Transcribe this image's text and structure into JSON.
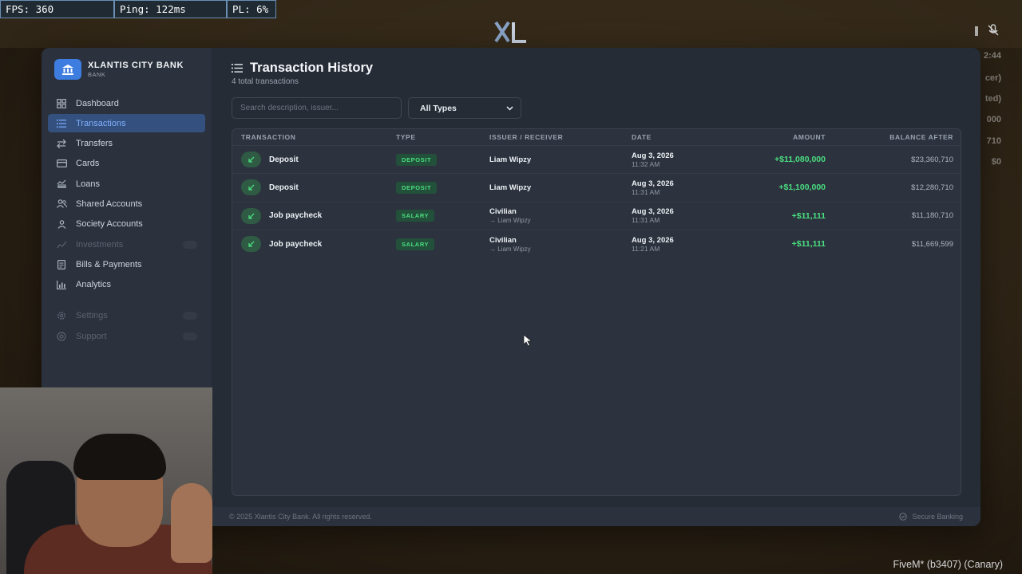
{
  "debug": {
    "fps": "FPS: 360",
    "ping": "Ping: 122ms",
    "pl": "PL: 6%"
  },
  "background_hud": [
    "2:44",
    "cer)",
    "ted)",
    "000",
    "710",
    "$0"
  ],
  "brand": {
    "title": "XLANTIS CITY BANK",
    "subtitle": "BANK",
    "icon": "bank-icon",
    "accent": "#3e7de0"
  },
  "nav": {
    "items": [
      {
        "label": "Dashboard",
        "icon": "dashboard-icon",
        "state": "normal"
      },
      {
        "label": "Transactions",
        "icon": "list-icon",
        "state": "active"
      },
      {
        "label": "Transfers",
        "icon": "transfer-icon",
        "state": "normal"
      },
      {
        "label": "Cards",
        "icon": "card-icon",
        "state": "normal"
      },
      {
        "label": "Loans",
        "icon": "loan-icon",
        "state": "normal"
      },
      {
        "label": "Shared Accounts",
        "icon": "users-icon",
        "state": "normal"
      },
      {
        "label": "Society Accounts",
        "icon": "society-icon",
        "state": "normal"
      },
      {
        "label": "Investments",
        "icon": "chart-icon",
        "state": "disabled"
      },
      {
        "label": "Bills & Payments",
        "icon": "bill-icon",
        "state": "normal"
      },
      {
        "label": "Analytics",
        "icon": "analytics-icon",
        "state": "normal"
      }
    ],
    "bottom_items": [
      {
        "label": "Settings",
        "icon": "gear-icon",
        "state": "disabled"
      },
      {
        "label": "Support",
        "icon": "support-icon",
        "state": "disabled"
      }
    ]
  },
  "page": {
    "title": "Transaction History",
    "subtitle": "4 total transactions",
    "search_placeholder": "Search description, issuer...",
    "type_filter": "All Types"
  },
  "table": {
    "columns": [
      "TRANSACTION",
      "TYPE",
      "ISSUER / RECEIVER",
      "DATE",
      "AMOUNT",
      "BALANCE AFTER"
    ],
    "rows": [
      {
        "label": "Deposit",
        "type": "DEPOSIT",
        "issuer": "Liam Wipzy",
        "receiver": "",
        "date": "Aug 3, 2026",
        "time": "11:32 AM",
        "amount": "+$11,080,000",
        "balance": "$23,360,710"
      },
      {
        "label": "Deposit",
        "type": "DEPOSIT",
        "issuer": "Liam Wipzy",
        "receiver": "",
        "date": "Aug 3, 2026",
        "time": "11:31 AM",
        "amount": "+$1,100,000",
        "balance": "$12,280,710"
      },
      {
        "label": "Job paycheck",
        "type": "SALARY",
        "issuer": "Civilian",
        "receiver": "→ Liam Wipzy",
        "date": "Aug 3, 2026",
        "time": "11:31 AM",
        "amount": "+$11,111",
        "balance": "$11,180,710"
      },
      {
        "label": "Job paycheck",
        "type": "SALARY",
        "issuer": "Civilian",
        "receiver": "→ Liam Wipzy",
        "date": "Aug 3, 2026",
        "time": "11:21 AM",
        "amount": "+$11,111",
        "balance": "$11,669,599"
      }
    ]
  },
  "footer": {
    "copyright": "© 2025 Xlantis City Bank. All rights reserved.",
    "secure": "Secure Banking"
  },
  "game_footer": "FiveM* (b3407) (Canary)",
  "colors": {
    "positive": "#4ade80",
    "active_nav": "#34507e",
    "panel": "#262c36"
  }
}
